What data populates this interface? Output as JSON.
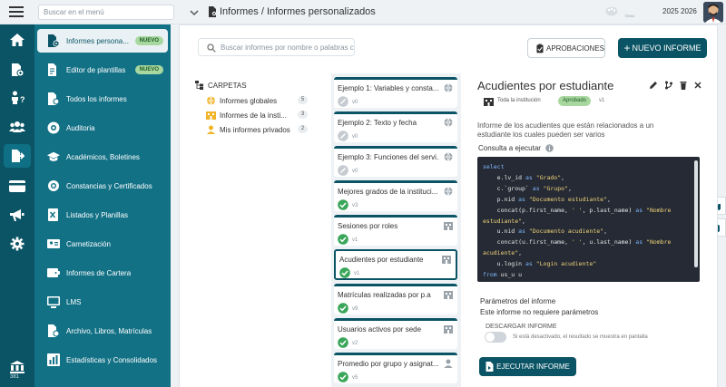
{
  "topbar": {
    "menu_search_placeholder": "Buscar en el menú",
    "breadcrumb": "Informes / Informes personalizados",
    "theme_label": "TEMA",
    "period": "2025 2026"
  },
  "rail": {
    "count": "381",
    "icons": [
      "home-icon",
      "student-enroll-icon",
      "person-help-icon",
      "users-icon",
      "reports-icon",
      "card-icon",
      "megaphone-icon",
      "gear-icon"
    ]
  },
  "nav": {
    "badge_new": "NUEVO",
    "items": [
      {
        "label": "Informes persona...",
        "icon": "report-settings-icon"
      },
      {
        "label": "Editor de plantillas",
        "icon": "template-editor-icon"
      },
      {
        "label": "Todos los informes",
        "icon": "all-reports-icon"
      },
      {
        "label": "Auditoria",
        "icon": "audit-icon"
      },
      {
        "label": "Académicos, Boletines",
        "icon": "graduation-cap-icon"
      },
      {
        "label": "Constancias y Certificados",
        "icon": "certificate-icon"
      },
      {
        "label": "Listados y Planillas",
        "icon": "list-icon"
      },
      {
        "label": "Carnetización",
        "icon": "id-card-icon"
      },
      {
        "label": "Informes de Cartera",
        "icon": "wallet-icon"
      },
      {
        "label": "LMS",
        "icon": "lms-icon"
      },
      {
        "label": "Archivo, Libros, Matrículas",
        "icon": "archive-icon"
      },
      {
        "label": "Estadísticas y Consolidados",
        "icon": "stats-icon"
      }
    ]
  },
  "toolbar": {
    "search_placeholder": "Buscar informes por nombre o palabras cl",
    "approvals_label": "APROBACIONES",
    "new_report_label": "NUEVO INFORME"
  },
  "folders": {
    "title": "CARPETAS",
    "items": [
      {
        "label": "Informes globales",
        "count": "5"
      },
      {
        "label": "Informes de la insti...",
        "count": "3"
      },
      {
        "label": "Mis informes privados",
        "count": "2"
      }
    ]
  },
  "reports": [
    {
      "name": "Ejemplo 1: Variables y consta...",
      "version": "v0",
      "status": "draft",
      "scope": "global"
    },
    {
      "name": "Ejemplo 2: Texto y fecha",
      "version": "v0",
      "status": "draft",
      "scope": "global"
    },
    {
      "name": "Ejemplo 3: Funciones del servi...",
      "version": "v0",
      "status": "draft",
      "scope": "global"
    },
    {
      "name": "Mejores grados de la instituci...",
      "version": "v3",
      "status": "approved",
      "scope": "global"
    },
    {
      "name": "Sesiones por roles",
      "version": "v1",
      "status": "approved",
      "scope": "institution"
    },
    {
      "name": "Acudientes por estudiante",
      "version": "v1",
      "status": "approved",
      "scope": "institution"
    },
    {
      "name": "Matrículas realizadas por p.a",
      "version": "v9",
      "status": "approved",
      "scope": "institution"
    },
    {
      "name": "Usuarios activos por sede",
      "version": "v2",
      "status": "approved",
      "scope": "institution"
    },
    {
      "name": "Promedio por grupo y asignat...",
      "version": "v5",
      "status": "approved",
      "scope": "private"
    }
  ],
  "detail": {
    "title": "Acudientes por estudiante",
    "scope": "Toda la institución",
    "status": "Aprobado",
    "version": "v1",
    "description": "Informe de los acudientes que están relacionados a un estudiante los cuales pueden ser varios",
    "query_label": "Consulta a ejecutar",
    "sql_lines": [
      "select",
      "    e.lv_id as \"Grado\",",
      "    c.`group` as \"Grupo\",",
      "    p.nid as \"Documento estudiante\",",
      "    concat(p.first_name, ' ', p.last_name) as \"Nombre estudiante\",",
      "    u.nid as \"Documento acudiente\",",
      "    concat(u.first_name, ' ', u.last_name) as \"Nombre acudiente\",",
      "    u.login as \"Login acudiente\"",
      "from us_u u"
    ],
    "params_label": "Parámetros del informe",
    "params_note": "Este informe no requiere parámetros",
    "download_label": "DESCARGAR INFORME",
    "download_hint": "Si está desactivado, el resultado se muestra en pantalla",
    "run_label": "EJECUTAR INFORME"
  },
  "colors": {
    "rail_bg": "#0b5465",
    "nav_bg": "#137186",
    "primary": "#0b5465",
    "badge_green": "#a8d8a0",
    "status_green": "#3aa65a"
  }
}
